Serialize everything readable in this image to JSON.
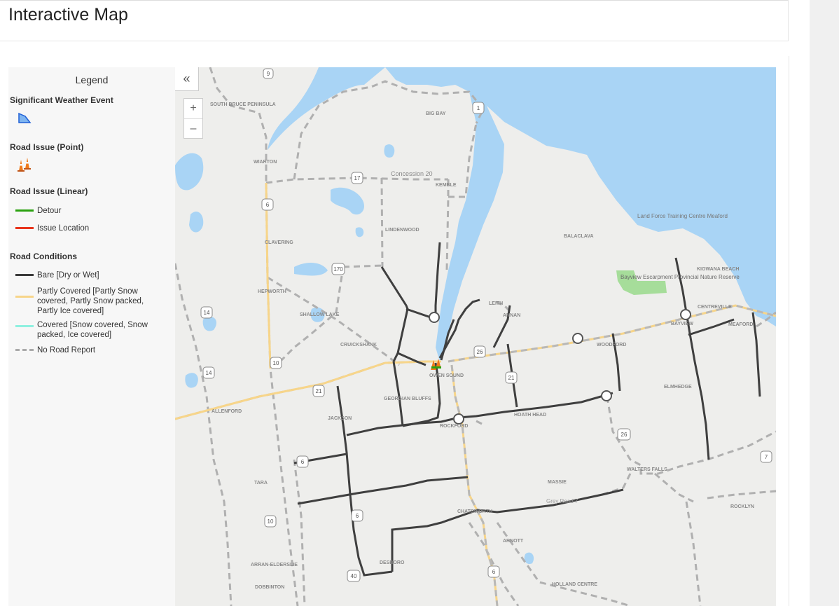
{
  "page": {
    "title": "Interactive Map"
  },
  "legend": {
    "title": "Legend",
    "sections": [
      {
        "heading": "Significant Weather Event",
        "icon": "weather-polygon-icon"
      },
      {
        "heading": "Road Issue (Point)",
        "icon": "traffic-cone-icon"
      },
      {
        "heading": "Road Issue (Linear)",
        "items": [
          {
            "label": "Detour",
            "color": "#2aa10f"
          },
          {
            "label": "Issue Location",
            "color": "#e8341c"
          }
        ]
      },
      {
        "heading": "Road Conditions",
        "items": [
          {
            "label": "Bare [Dry or Wet]",
            "color": "#3a3a3a"
          },
          {
            "label": "Partly Covered [Partly Snow covered, Partly Snow packed, Partly Ice covered]",
            "color": "#f7d58a"
          },
          {
            "label": "Covered [Snow covered, Snow packed, Ice covered]",
            "color": "#8ff0e0"
          },
          {
            "label": "No Road Report",
            "color": "#aaaaaa"
          }
        ]
      }
    ]
  },
  "map": {
    "collapse_icon": "double-chevron-left-icon",
    "zoom_in": "+",
    "zoom_out": "–",
    "water_color": "#a9d4f5",
    "land_color": "#eeeeec",
    "park_color": "#a6dd9a",
    "place_labels": [
      "SOUTH BRUCE PENINSULA",
      "BIG BAY",
      "WIARTON",
      "Concession 20",
      "KEMBLE",
      "LINDENWOOD",
      "CLAVERING",
      "BALACLAVA",
      "Land Force Training Centre Meaford",
      "HEPWORTH",
      "Bayview Escarpment Provincial Nature Reserve",
      "KIOWANA BEACH",
      "LEITH",
      "ANNAN",
      "CENTREVILLE",
      "BAYVIEW",
      "MEAFORD",
      "SHALLOW LAKE",
      "CRUICKSHANK",
      "WOODFORD",
      "KEMBLE",
      "OWEN SOUND",
      "ELMHEDGE",
      "GEORGIAN BLUFFS",
      "ALLENFORD",
      "JACKSON",
      "ROCKFORD",
      "HOATH HEAD",
      "TARA",
      "WALTERS FALLS",
      "MASSIE",
      "Grey Road 7",
      "ROCKLYN",
      "CHATSWORTH",
      "ARNOTT",
      "ARRAN-ELDERSLIE",
      "DESBORO",
      "DOBBINTON",
      "HOLLAND CENTRE"
    ],
    "route_shields": [
      "9",
      "1",
      "17",
      "6",
      "170",
      "14",
      "14",
      "10",
      "21",
      "26",
      "21",
      "26",
      "6",
      "10",
      "6",
      "40",
      "6",
      "7"
    ]
  }
}
